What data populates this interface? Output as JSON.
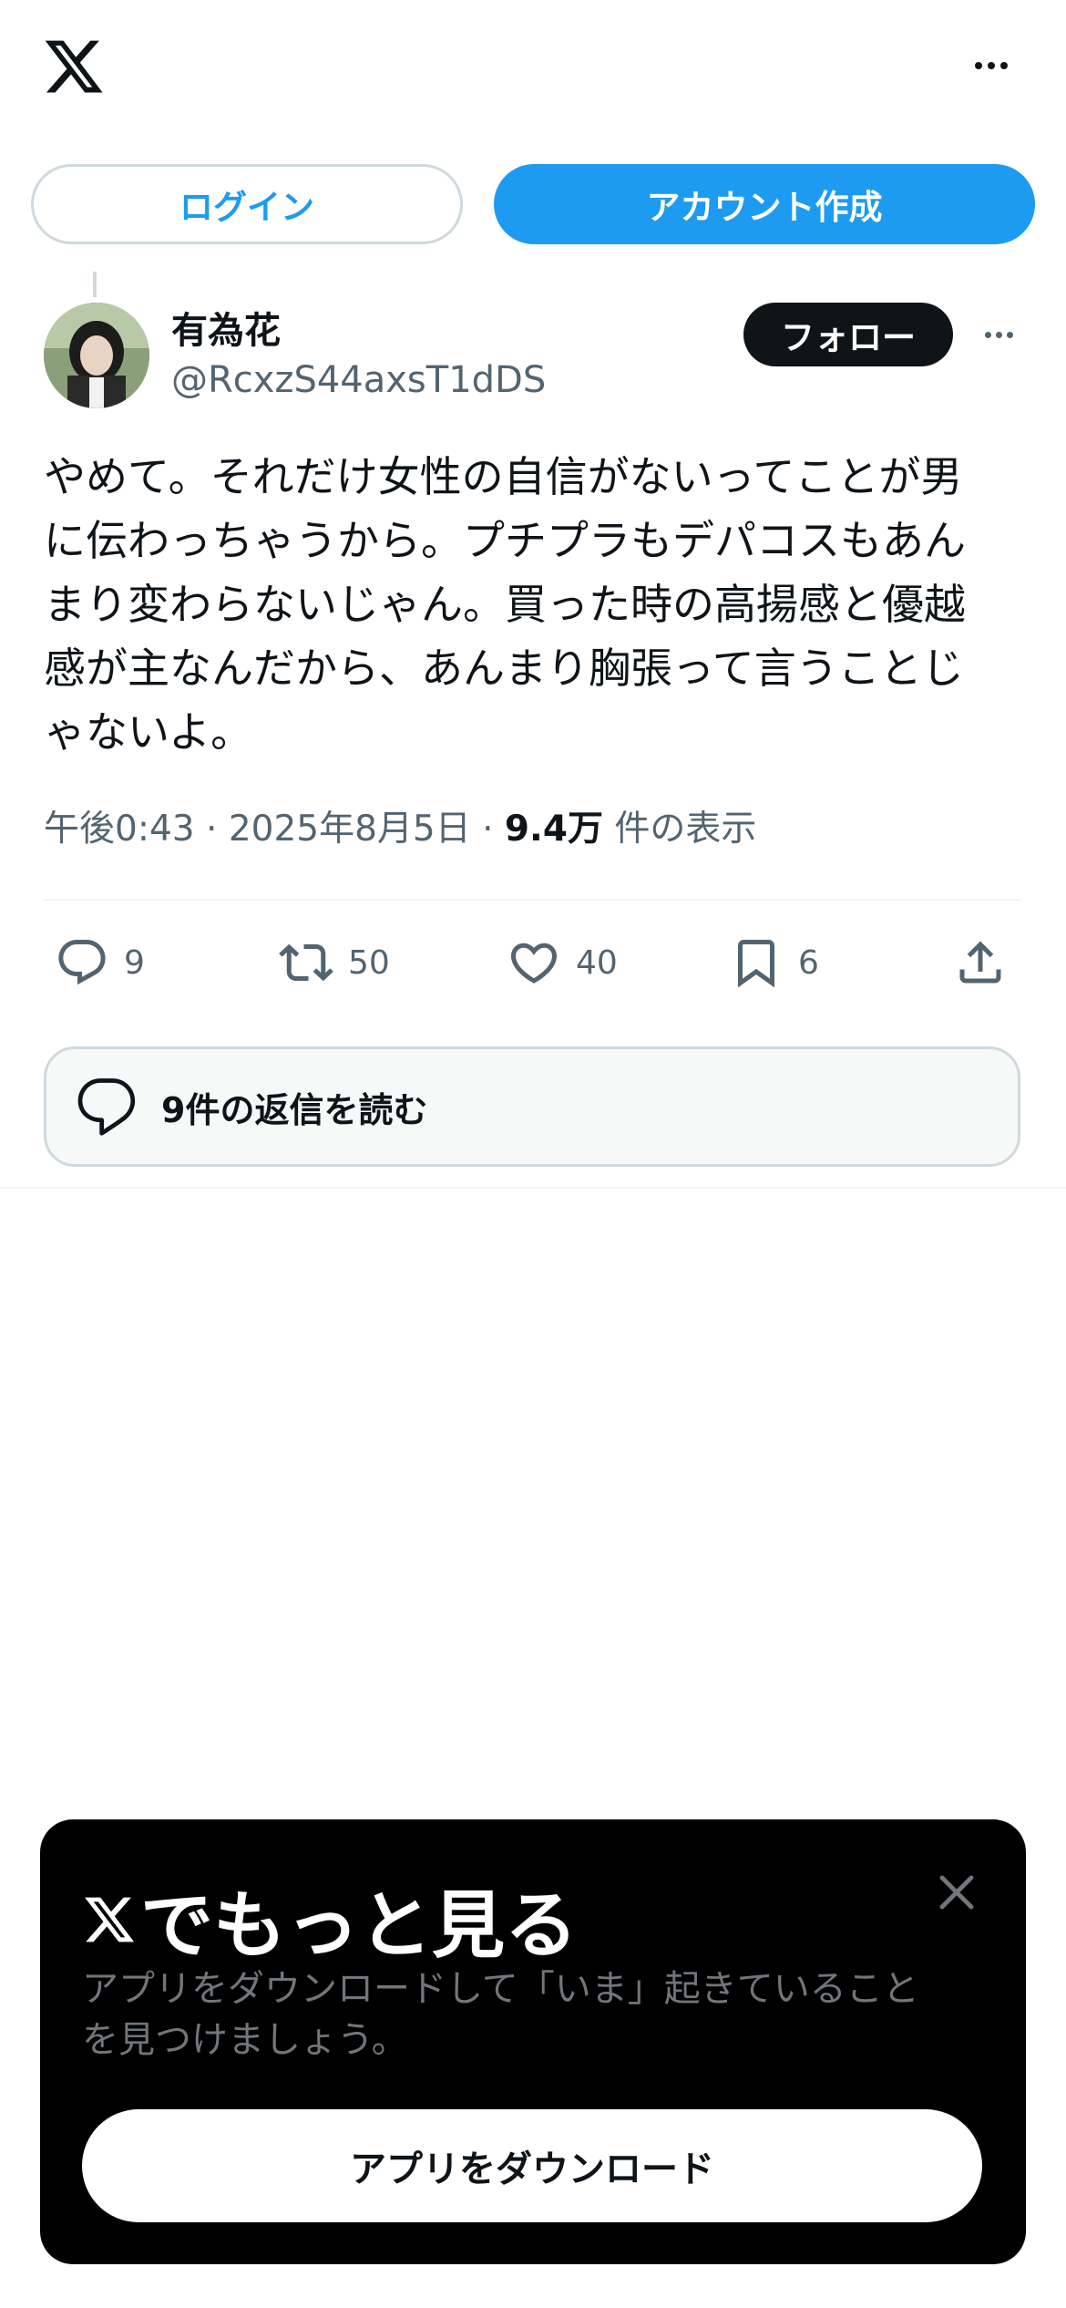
{
  "header": {
    "logo_icon": "x-logo-icon",
    "more_icon": "more-horizontal-icon"
  },
  "auth": {
    "login_label": "ログイン",
    "signup_label": "アカウント作成"
  },
  "tweet": {
    "display_name": "有為花",
    "handle": "@RcxzS44axsT1dDS",
    "follow_label": "フォロー",
    "text": "やめて。それだけ女性の自信がないってことが男\nに伝わっちゃうから。プチプラもデパコスもあん\nまり変わらないじゃん。買った時の高揚感と優越\n感が主なんだから、あんまり胸張って言うことじ\nゃないよ。",
    "time": "午後0:43",
    "separator": "·",
    "date": "2025年8月5日",
    "views_count": "9.4万",
    "views_label": "件の表示",
    "actions": {
      "reply_count": "9",
      "retweet_count": "50",
      "like_count": "40",
      "bookmark_count": "6"
    },
    "read_replies_label": "9件の返信を読む"
  },
  "banner": {
    "title": "でもっと見る",
    "description": "アプリをダウンロードして「いま」起きていること\nを見つけましょう。",
    "download_label": "アプリをダウンロード"
  },
  "colors": {
    "accent": "#1d9bf0",
    "text": "#0f1419",
    "secondary": "#536471",
    "border": "#cfd9de"
  }
}
